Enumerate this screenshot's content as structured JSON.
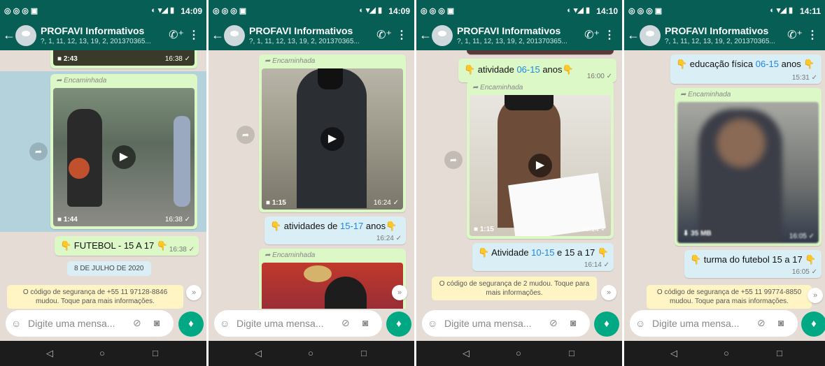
{
  "panels": [
    {
      "status_time": "14:09",
      "title": "PROFAVI Informativos",
      "subtitle": "?, 1, 11, 12, 13, 19, 2, 201370365...",
      "top_video": {
        "dur": "2:43",
        "time": "16:38 ✓"
      },
      "video": {
        "forwarded": "Encaminhada",
        "dur": "1:44",
        "time": "16:38 ✓"
      },
      "caption": {
        "text": "👇 FUTEBOL - 15 A 17 👇",
        "time": "16:38 ✓"
      },
      "date": "8 DE JULHO DE 2020",
      "system": "O código de segurança de +55 11 97128-8846 mudou. Toque para mais informações.",
      "placeholder": "Digite uma mensa..."
    },
    {
      "status_time": "14:09",
      "title": "PROFAVI Informativos",
      "subtitle": "?, 1, 11, 12, 13, 19, 2, 201370365...",
      "video": {
        "forwarded": "Encaminhada",
        "dur": "1:15",
        "time": "16:24 ✓"
      },
      "caption": {
        "pre": "👇 atividades de ",
        "hl": "15-17",
        "post": " anos👇",
        "time": "16:24 ✓"
      },
      "video2": {
        "forwarded": "Encaminhada"
      },
      "placeholder": "Digite uma mensa..."
    },
    {
      "status_time": "14:10",
      "title": "PROFAVI Informativos",
      "subtitle": "?, 1, 11, 12, 13, 19, 2, 201370365...",
      "caption_top": {
        "pre": "👇 atividade ",
        "hl": "06-15",
        "post": " anos👇",
        "time": "16:00 ✓"
      },
      "video": {
        "forwarded": "Encaminhada",
        "dur": "1:15",
        "time": "16:14 ✓"
      },
      "caption": {
        "pre": "👇 Atividade ",
        "hl": "10-15",
        "post": " e 15 a 17 👇",
        "time": "16:14 ✓"
      },
      "system": "O código de segurança de 2 mudou. Toque para mais informações.",
      "placeholder": "Digite uma mensa..."
    },
    {
      "status_time": "14:11",
      "title": "PROFAVI Informativos",
      "subtitle": "?, 1, 11, 12, 13, 19, 2, 201370365...",
      "caption_top": {
        "pre": "👇 educação física ",
        "hl": "06-15",
        "post": " anos 👇",
        "time": "15:31 ✓"
      },
      "video": {
        "forwarded": "Encaminhada",
        "size": "35 MB",
        "time": "16:05 ✓"
      },
      "caption": {
        "text": "👇 turma do futebol 15 a 17 👇",
        "time": "16:05 ✓"
      },
      "system": "O código de segurança de +55 11 99774-8850 mudou. Toque para mais informações.",
      "placeholder": "Digite uma mensa..."
    }
  ],
  "colors": {
    "header": "#075e54",
    "outgoing": "#dcf8c6",
    "accent": "#00a884",
    "highlight": "#1e88e5"
  },
  "icons": [
    "back-arrow-icon",
    "add-call-icon",
    "more-vert-icon",
    "play-icon",
    "video-camera-icon",
    "forward-icon",
    "emoji-icon",
    "attach-icon",
    "camera-icon",
    "mic-icon",
    "nav-back-icon",
    "nav-home-icon",
    "nav-recent-icon",
    "download-icon",
    "scroll-down-icon"
  ]
}
